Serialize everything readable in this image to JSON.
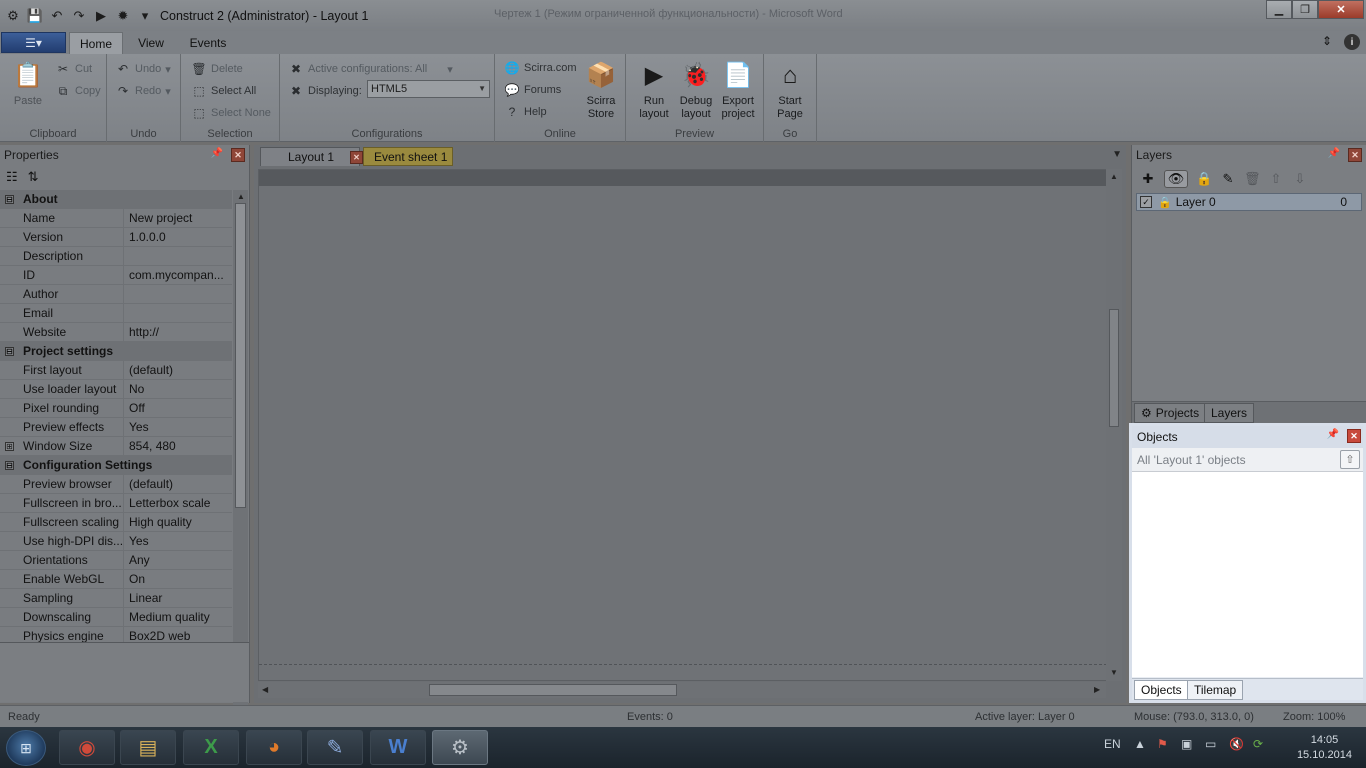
{
  "window": {
    "title": "Construct 2 (Administrator) - Layout 1",
    "ghost_title": "Чертеж 1 (Режим ограниченной функциональности) - Microsoft Word",
    "close_glyph": "✕",
    "min_glyph": "▁",
    "max_glyph": "❐"
  },
  "ribbon_tabs": {
    "home": "Home",
    "view": "View",
    "events": "Events",
    "file_glyph": "☰▾",
    "collapse_glyph": "⇕",
    "info_glyph": "i"
  },
  "ribbon": {
    "clipboard": {
      "paste": "Paste",
      "cut": "Cut",
      "copy": "Copy",
      "label": "Clipboard"
    },
    "undo": {
      "undo": "Undo",
      "redo": "Redo",
      "label": "Undo"
    },
    "selection": {
      "delete": "Delete",
      "select_all": "Select All",
      "select_none": "Select None",
      "label": "Selection"
    },
    "configurations": {
      "active": "Active configurations: All",
      "displaying_label": "Displaying:",
      "displaying_value": "HTML5",
      "label": "Configurations"
    },
    "online": {
      "scirra": "Scirra.com",
      "forums": "Forums",
      "help": "Help",
      "store_line1": "Scirra",
      "store_line2": "Store",
      "label": "Online"
    },
    "preview": {
      "run_line1": "Run",
      "run_line2": "layout",
      "debug_line1": "Debug",
      "debug_line2": "layout",
      "export_line1": "Export",
      "export_line2": "project",
      "label": "Preview"
    },
    "go": {
      "start_line1": "Start",
      "start_line2": "Page",
      "label": "Go"
    }
  },
  "properties": {
    "title": "Properties",
    "rows": [
      {
        "type": "category",
        "key": "About",
        "expander": "⊟"
      },
      {
        "type": "prop",
        "key": "Name",
        "value": "New project"
      },
      {
        "type": "prop",
        "key": "Version",
        "value": "1.0.0.0"
      },
      {
        "type": "prop",
        "key": "Description",
        "value": ""
      },
      {
        "type": "prop",
        "key": "ID",
        "value": "com.mycompan..."
      },
      {
        "type": "prop",
        "key": "Author",
        "value": ""
      },
      {
        "type": "prop",
        "key": "Email",
        "value": ""
      },
      {
        "type": "prop",
        "key": "Website",
        "value": "http://"
      },
      {
        "type": "category",
        "key": "Project settings",
        "expander": "⊟"
      },
      {
        "type": "prop",
        "key": "First layout",
        "value": "(default)"
      },
      {
        "type": "prop",
        "key": "Use loader layout",
        "value": "No"
      },
      {
        "type": "prop",
        "key": "Pixel rounding",
        "value": "Off"
      },
      {
        "type": "prop",
        "key": "Preview effects",
        "value": "Yes"
      },
      {
        "type": "prop",
        "key": "Window Size",
        "value": "854, 480",
        "expander": "⊞"
      },
      {
        "type": "category",
        "key": "Configuration Settings",
        "expander": "⊟"
      },
      {
        "type": "prop",
        "key": "Preview browser",
        "value": "(default)"
      },
      {
        "type": "prop",
        "key": "Fullscreen in bro...",
        "value": "Letterbox scale"
      },
      {
        "type": "prop",
        "key": "Fullscreen scaling",
        "value": "High quality"
      },
      {
        "type": "prop",
        "key": "Use high-DPI dis...",
        "value": "Yes"
      },
      {
        "type": "prop",
        "key": "Orientations",
        "value": "Any"
      },
      {
        "type": "prop",
        "key": "Enable WebGL",
        "value": "On"
      },
      {
        "type": "prop",
        "key": "Sampling",
        "value": "Linear"
      },
      {
        "type": "prop",
        "key": "Downscaling",
        "value": "Medium quality"
      },
      {
        "type": "prop",
        "key": "Physics engine",
        "value": "Box2D web"
      }
    ]
  },
  "doc_tabs": {
    "layout": "Layout 1",
    "event_sheet": "Event sheet 1",
    "close_glyph": "✕",
    "list_glyph": "▼"
  },
  "layers": {
    "title": "Layers",
    "layer_name": "Layer 0",
    "layer_index": "0",
    "check_glyph": "✓",
    "tab_projects": "Projects",
    "tab_layers": "Layers"
  },
  "objects": {
    "title": "Objects",
    "filter_text": "All 'Layout 1' objects",
    "tab_objects": "Objects",
    "tab_tilemap": "Tilemap"
  },
  "statusbar": {
    "ready": "Ready",
    "events": "Events: 0",
    "active_layer": "Active layer: Layer 0",
    "mouse": "Mouse: (793.0, 313.0, 0)",
    "zoom": "Zoom: 100%"
  },
  "taskbar": {
    "lang": "EN",
    "time": "14:05",
    "date": "15.10.2014"
  }
}
